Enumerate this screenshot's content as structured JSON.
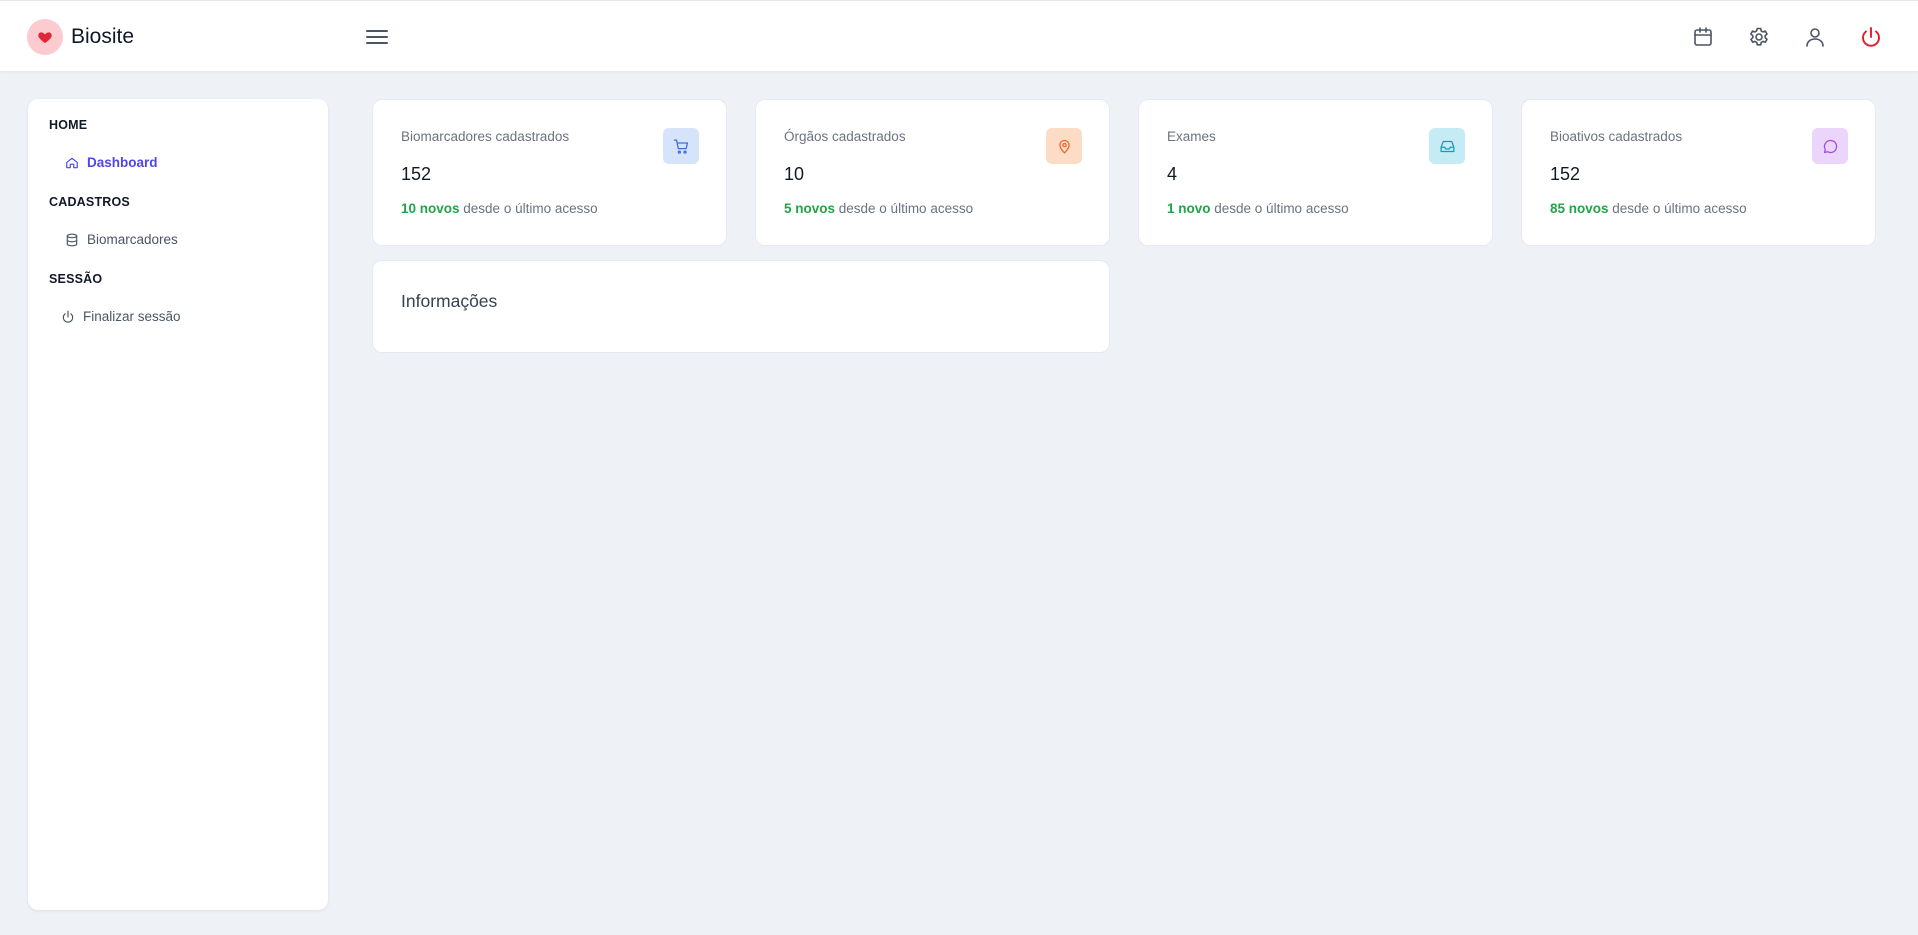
{
  "app": {
    "name": "Biosite"
  },
  "header": {
    "icons": [
      "heart-icon",
      "menu-icon",
      "calendar-icon",
      "settings-icon",
      "user-icon",
      "power-icon"
    ]
  },
  "sidebar": {
    "sections": [
      {
        "title": "HOME",
        "items": [
          {
            "label": "Dashboard",
            "icon": "home-icon",
            "active": true
          }
        ]
      },
      {
        "title": "CADASTROS",
        "items": [
          {
            "label": "Biomarcadores",
            "icon": "database-icon"
          }
        ]
      },
      {
        "title": "SESSÃO",
        "items": [
          {
            "label": "Finalizar sessão",
            "icon": "power-icon"
          }
        ]
      }
    ]
  },
  "stats": [
    {
      "title": "Biomarcadores cadastrados",
      "value": "152",
      "new": "10 novos",
      "suffix": " desde o último acesso",
      "icon": "cart-icon",
      "icon_bg": "#d6e4fb",
      "icon_color": "#3b6fd8"
    },
    {
      "title": "Órgãos cadastrados",
      "value": "10",
      "new": "5 novos",
      "suffix": " desde o último acesso",
      "icon": "map-pin-icon",
      "icon_bg": "#fcdcc4",
      "icon_color": "#e8652b"
    },
    {
      "title": "Exames",
      "value": "4",
      "new": "1 novo",
      "suffix": " desde o último acesso",
      "icon": "inbox-icon",
      "icon_bg": "#c5ecf4",
      "icon_color": "#1a9db4"
    },
    {
      "title": "Bioativos cadastrados",
      "value": "152",
      "new": "85 novos",
      "suffix": " desde o último acesso",
      "icon": "message-icon",
      "icon_bg": "#ebd5fb",
      "icon_color": "#9a4fe0"
    }
  ],
  "info": {
    "title": "Informações"
  },
  "colors": {
    "accent": "#4f46e5",
    "positive": "#22a447",
    "power": "#e11d2a",
    "background": "#eef1f6"
  }
}
